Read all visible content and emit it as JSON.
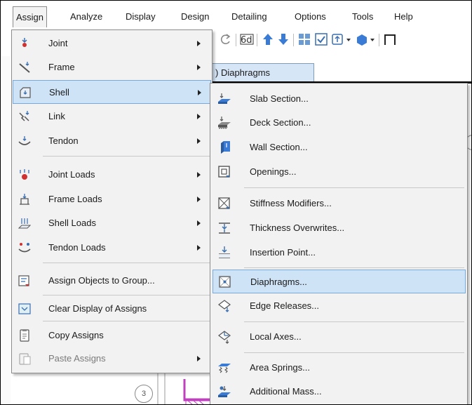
{
  "menubar": {
    "items": [
      "Assign",
      "Analyze",
      "Display",
      "Design",
      "Detailing",
      "Options",
      "Tools",
      "Help"
    ],
    "active": "Assign"
  },
  "background": {
    "tab_label": ") Diaphragms",
    "circle_label": "3"
  },
  "assign_menu": {
    "items": [
      {
        "label": "Joint",
        "icon": "joint-icon",
        "submenu": true
      },
      {
        "label": "Frame",
        "icon": "frame-icon",
        "submenu": true
      },
      {
        "label": "Shell",
        "icon": "shell-icon",
        "submenu": true,
        "highlighted": true
      },
      {
        "label": "Link",
        "icon": "link-icon",
        "submenu": true
      },
      {
        "label": "Tendon",
        "icon": "tendon-icon",
        "submenu": true
      },
      {
        "label": "Joint Loads",
        "icon": "joint-loads-icon",
        "submenu": true
      },
      {
        "label": "Frame Loads",
        "icon": "frame-loads-icon",
        "submenu": true
      },
      {
        "label": "Shell Loads",
        "icon": "shell-loads-icon",
        "submenu": true
      },
      {
        "label": "Tendon Loads",
        "icon": "tendon-loads-icon",
        "submenu": true
      },
      {
        "label": "Assign Objects to Group...",
        "icon": "group-icon",
        "submenu": false
      },
      {
        "label": "Clear Display of Assigns",
        "icon": "clear-display-icon",
        "submenu": false
      },
      {
        "label": "Copy Assigns",
        "icon": "copy-icon",
        "submenu": false
      },
      {
        "label": "Paste Assigns",
        "icon": "paste-icon",
        "submenu": true,
        "disabled": true
      }
    ]
  },
  "shell_submenu": {
    "items": [
      {
        "label": "Slab Section...",
        "icon": "slab-section-icon"
      },
      {
        "label": "Deck Section...",
        "icon": "deck-section-icon"
      },
      {
        "label": "Wall Section...",
        "icon": "wall-section-icon"
      },
      {
        "label": "Openings...",
        "icon": "openings-icon"
      },
      {
        "label": "Stiffness Modifiers...",
        "icon": "stiffness-modifiers-icon"
      },
      {
        "label": "Thickness Overwrites...",
        "icon": "thickness-overwrites-icon"
      },
      {
        "label": "Insertion Point...",
        "icon": "insertion-point-icon"
      },
      {
        "label": "Diaphragms...",
        "icon": "diaphragms-icon",
        "highlighted": true
      },
      {
        "label": "Edge Releases...",
        "icon": "edge-releases-icon"
      },
      {
        "label": "Local Axes...",
        "icon": "local-axes-icon"
      },
      {
        "label": "Area Springs...",
        "icon": "area-springs-icon"
      },
      {
        "label": "Additional Mass...",
        "icon": "additional-mass-icon"
      }
    ]
  },
  "colors": {
    "highlight_fill": "#cfe3f7",
    "highlight_border": "#79a9dc",
    "menu_bg": "#f2f2f2",
    "icon_blue": "#3a7bd5",
    "icon_red": "#d03030"
  }
}
